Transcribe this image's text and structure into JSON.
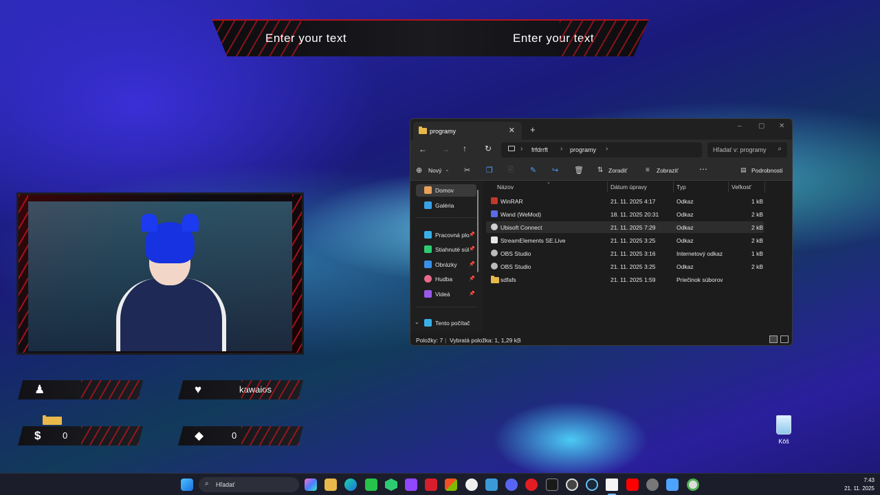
{
  "overlay": {
    "banner_left": "Enter your text",
    "banner_right": "Enter your text",
    "follower_value": "",
    "heart_value": "kawaios",
    "money_value": "0",
    "diamond_value": "0",
    "accent_color": "#b0131f"
  },
  "desktop": {
    "recycle_bin_label": "Kôš"
  },
  "explorer": {
    "tab_title": "programy",
    "breadcrumb": [
      "frfdrrft",
      "programy"
    ],
    "search_placeholder": "Hľadať v: programy",
    "toolbar": {
      "new_label": "Nový",
      "sort_label": "Zoradiť",
      "view_label": "Zobraziť",
      "details_label": "Podrobnosti"
    },
    "nav": [
      {
        "label": "Domov",
        "icon": "home-icon",
        "color": "#e8a15a",
        "pinned": false
      },
      {
        "label": "Galéria",
        "icon": "gallery-icon",
        "color": "#3aa2e8",
        "pinned": false
      },
      {
        "label": "Pracovná plo",
        "icon": "desktop-icon",
        "color": "#3ab0e8",
        "pinned": true
      },
      {
        "label": "Stiahnuté súl",
        "icon": "download-icon",
        "color": "#2ecc71",
        "pinned": true
      },
      {
        "label": "Obrázky",
        "icon": "pictures-icon",
        "color": "#3a90e8",
        "pinned": true
      },
      {
        "label": "Hudba",
        "icon": "music-icon",
        "color": "#e86a8a",
        "pinned": true
      },
      {
        "label": "Videá",
        "icon": "videos-icon",
        "color": "#9a5ae8",
        "pinned": true
      },
      {
        "label": "Tento počítač",
        "icon": "computer-icon",
        "color": "#3ab0e8",
        "pinned": false
      }
    ],
    "columns": [
      "Názov",
      "Dátum úpravy",
      "Typ",
      "Veľkosť"
    ],
    "rows": [
      {
        "name": "WinRAR",
        "date": "21. 11. 2025 4:17",
        "type": "Odkaz",
        "size": "1 kB",
        "icon_color": "#c0392b"
      },
      {
        "name": "Wand (WeMod)",
        "date": "18. 11. 2025 20:31",
        "type": "Odkaz",
        "size": "2 kB",
        "icon_color": "#5a6ae8"
      },
      {
        "name": "Ubisoft Connect",
        "date": "21. 11. 2025 7:29",
        "type": "Odkaz",
        "size": "2 kB",
        "icon_color": "#d0d0d0"
      },
      {
        "name": "StreamElements SE.Live",
        "date": "21. 11. 2025 3:25",
        "type": "Odkaz",
        "size": "2 kB",
        "icon_color": "#e6e6e6"
      },
      {
        "name": "OBS Studio",
        "date": "21. 11. 2025 3:16",
        "type": "Internetový odkaz",
        "size": "1 kB",
        "icon_color": "#bbbbbb"
      },
      {
        "name": "OBS Studio",
        "date": "21. 11. 2025 3:25",
        "type": "Odkaz",
        "size": "2 kB",
        "icon_color": "#bbbbbb"
      },
      {
        "name": "sdfafs",
        "date": "21. 11. 2025 1:59",
        "type": "Priečinok súborov",
        "size": "",
        "icon_color": "#e8b84a"
      }
    ],
    "status": {
      "items": "Položky: 7",
      "selected": "Vybratá položka: 1, 1,29 kB"
    }
  },
  "taskbar": {
    "search_placeholder": "Hľadať",
    "time": "7:43",
    "date": "21. 11. 2025"
  }
}
